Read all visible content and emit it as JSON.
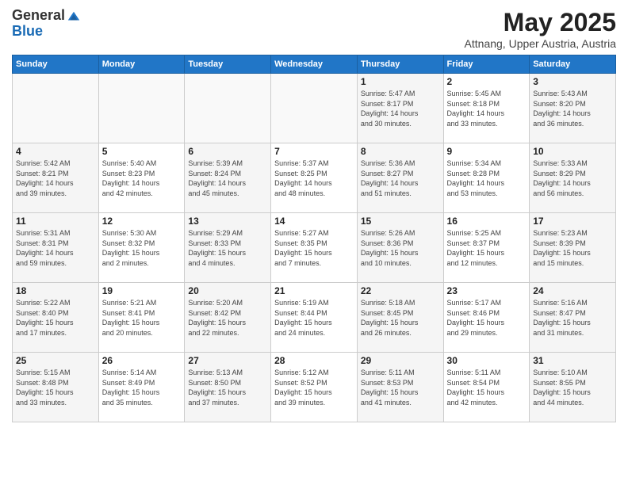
{
  "logo": {
    "general": "General",
    "blue": "Blue"
  },
  "title": "May 2025",
  "subtitle": "Attnang, Upper Austria, Austria",
  "days": [
    "Sunday",
    "Monday",
    "Tuesday",
    "Wednesday",
    "Thursday",
    "Friday",
    "Saturday"
  ],
  "weeks": [
    [
      {
        "day": "",
        "content": ""
      },
      {
        "day": "",
        "content": ""
      },
      {
        "day": "",
        "content": ""
      },
      {
        "day": "",
        "content": ""
      },
      {
        "day": "1",
        "content": "Sunrise: 5:47 AM\nSunset: 8:17 PM\nDaylight: 14 hours\nand 30 minutes."
      },
      {
        "day": "2",
        "content": "Sunrise: 5:45 AM\nSunset: 8:18 PM\nDaylight: 14 hours\nand 33 minutes."
      },
      {
        "day": "3",
        "content": "Sunrise: 5:43 AM\nSunset: 8:20 PM\nDaylight: 14 hours\nand 36 minutes."
      }
    ],
    [
      {
        "day": "4",
        "content": "Sunrise: 5:42 AM\nSunset: 8:21 PM\nDaylight: 14 hours\nand 39 minutes."
      },
      {
        "day": "5",
        "content": "Sunrise: 5:40 AM\nSunset: 8:23 PM\nDaylight: 14 hours\nand 42 minutes."
      },
      {
        "day": "6",
        "content": "Sunrise: 5:39 AM\nSunset: 8:24 PM\nDaylight: 14 hours\nand 45 minutes."
      },
      {
        "day": "7",
        "content": "Sunrise: 5:37 AM\nSunset: 8:25 PM\nDaylight: 14 hours\nand 48 minutes."
      },
      {
        "day": "8",
        "content": "Sunrise: 5:36 AM\nSunset: 8:27 PM\nDaylight: 14 hours\nand 51 minutes."
      },
      {
        "day": "9",
        "content": "Sunrise: 5:34 AM\nSunset: 8:28 PM\nDaylight: 14 hours\nand 53 minutes."
      },
      {
        "day": "10",
        "content": "Sunrise: 5:33 AM\nSunset: 8:29 PM\nDaylight: 14 hours\nand 56 minutes."
      }
    ],
    [
      {
        "day": "11",
        "content": "Sunrise: 5:31 AM\nSunset: 8:31 PM\nDaylight: 14 hours\nand 59 minutes."
      },
      {
        "day": "12",
        "content": "Sunrise: 5:30 AM\nSunset: 8:32 PM\nDaylight: 15 hours\nand 2 minutes."
      },
      {
        "day": "13",
        "content": "Sunrise: 5:29 AM\nSunset: 8:33 PM\nDaylight: 15 hours\nand 4 minutes."
      },
      {
        "day": "14",
        "content": "Sunrise: 5:27 AM\nSunset: 8:35 PM\nDaylight: 15 hours\nand 7 minutes."
      },
      {
        "day": "15",
        "content": "Sunrise: 5:26 AM\nSunset: 8:36 PM\nDaylight: 15 hours\nand 10 minutes."
      },
      {
        "day": "16",
        "content": "Sunrise: 5:25 AM\nSunset: 8:37 PM\nDaylight: 15 hours\nand 12 minutes."
      },
      {
        "day": "17",
        "content": "Sunrise: 5:23 AM\nSunset: 8:39 PM\nDaylight: 15 hours\nand 15 minutes."
      }
    ],
    [
      {
        "day": "18",
        "content": "Sunrise: 5:22 AM\nSunset: 8:40 PM\nDaylight: 15 hours\nand 17 minutes."
      },
      {
        "day": "19",
        "content": "Sunrise: 5:21 AM\nSunset: 8:41 PM\nDaylight: 15 hours\nand 20 minutes."
      },
      {
        "day": "20",
        "content": "Sunrise: 5:20 AM\nSunset: 8:42 PM\nDaylight: 15 hours\nand 22 minutes."
      },
      {
        "day": "21",
        "content": "Sunrise: 5:19 AM\nSunset: 8:44 PM\nDaylight: 15 hours\nand 24 minutes."
      },
      {
        "day": "22",
        "content": "Sunrise: 5:18 AM\nSunset: 8:45 PM\nDaylight: 15 hours\nand 26 minutes."
      },
      {
        "day": "23",
        "content": "Sunrise: 5:17 AM\nSunset: 8:46 PM\nDaylight: 15 hours\nand 29 minutes."
      },
      {
        "day": "24",
        "content": "Sunrise: 5:16 AM\nSunset: 8:47 PM\nDaylight: 15 hours\nand 31 minutes."
      }
    ],
    [
      {
        "day": "25",
        "content": "Sunrise: 5:15 AM\nSunset: 8:48 PM\nDaylight: 15 hours\nand 33 minutes."
      },
      {
        "day": "26",
        "content": "Sunrise: 5:14 AM\nSunset: 8:49 PM\nDaylight: 15 hours\nand 35 minutes."
      },
      {
        "day": "27",
        "content": "Sunrise: 5:13 AM\nSunset: 8:50 PM\nDaylight: 15 hours\nand 37 minutes."
      },
      {
        "day": "28",
        "content": "Sunrise: 5:12 AM\nSunset: 8:52 PM\nDaylight: 15 hours\nand 39 minutes."
      },
      {
        "day": "29",
        "content": "Sunrise: 5:11 AM\nSunset: 8:53 PM\nDaylight: 15 hours\nand 41 minutes."
      },
      {
        "day": "30",
        "content": "Sunrise: 5:11 AM\nSunset: 8:54 PM\nDaylight: 15 hours\nand 42 minutes."
      },
      {
        "day": "31",
        "content": "Sunrise: 5:10 AM\nSunset: 8:55 PM\nDaylight: 15 hours\nand 44 minutes."
      }
    ]
  ]
}
